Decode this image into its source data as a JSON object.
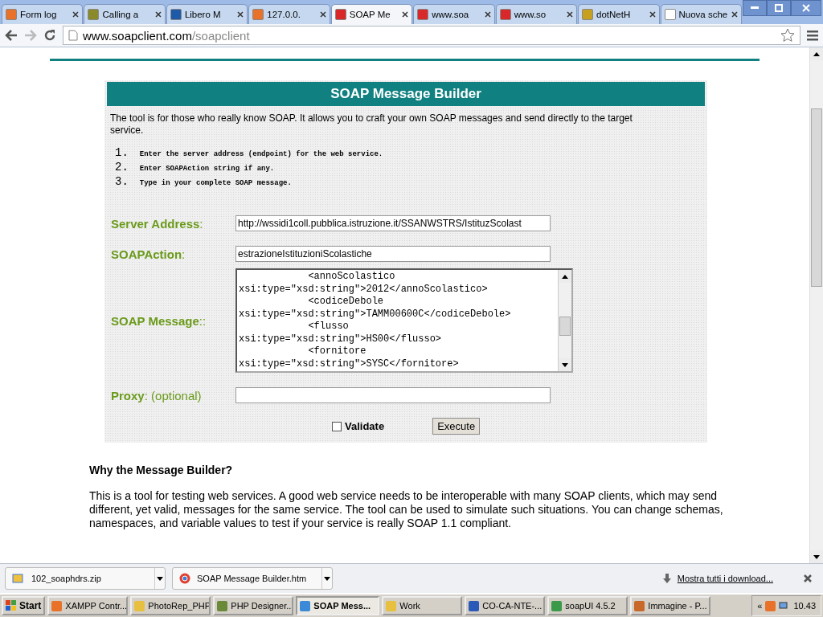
{
  "browser": {
    "tabs": [
      {
        "label": "Form log",
        "selected": false,
        "color": "#e8722a"
      },
      {
        "label": "Calling a",
        "selected": false,
        "color": "#8a8a2a"
      },
      {
        "label": "Libero M",
        "selected": false,
        "color": "#1e5aa8"
      },
      {
        "label": "127.0.0.",
        "selected": false,
        "color": "#e8722a"
      },
      {
        "label": "SOAP Me",
        "selected": true,
        "color": "#d8282a"
      },
      {
        "label": "www.soa",
        "selected": false,
        "color": "#d8282a"
      },
      {
        "label": "www.so",
        "selected": false,
        "color": "#d8282a"
      },
      {
        "label": "dotNetH",
        "selected": false,
        "color": "#c8a020"
      },
      {
        "label": "Nuova sche",
        "selected": false,
        "color": "#ffffff"
      }
    ],
    "url_host": "www.soapclient.com",
    "url_path": "/soapclient"
  },
  "builder": {
    "title": "SOAP Message Builder",
    "intro": "The tool is for those who really know  SOAP. It allows you to craft your own  SOAP messages and send directly  to the target service.",
    "steps": [
      {
        "number": "1.",
        "text": "Enter the server address (endpoint) for the web service."
      },
      {
        "number": "2.",
        "text": "Enter SOAPAction string if any."
      },
      {
        "number": "3.",
        "text": "Type in your complete SOAP message."
      }
    ],
    "server_address": {
      "label": "Server Address",
      "suffix": ":",
      "value": "http://wssidi1coll.pubblica.istruzione.it/SSANWSTRS/IstituzScolast"
    },
    "soap_action": {
      "label": "SOAPAction",
      "suffix": ":",
      "value": "estrazioneIstituzioniScolastiche"
    },
    "soap_message": {
      "label": "SOAP Message",
      "suffix": "::",
      "lines": [
        "            <annoScolastico",
        "xsi:type=\"xsd:string\">2012</annoScolastico>",
        "            <codiceDebole",
        "xsi:type=\"xsd:string\">TAMM00600C</codiceDebole>",
        "            <flusso",
        "xsi:type=\"xsd:string\">HS00</flusso>",
        "            <fornitore",
        "xsi:type=\"xsd:string\">SYSC</fornitore>"
      ]
    },
    "proxy": {
      "label": "Proxy",
      "suffix": ": (optional)"
    },
    "validate": {
      "label": "Validate",
      "checked": false
    },
    "execute_label": "Execute"
  },
  "why": {
    "heading": "Why the Message Builder?",
    "text": "This is a tool for testing web services. A good web service needs to be interoperable with many SOAP clients, which may send different, yet valid, messages for the same service. The tool can be used to simulate such situations. You can change schemas, namespaces, and variable values to test if your service is really SOAP 1.1 compliant."
  },
  "downloads": {
    "items": [
      {
        "name": "102_soaphdrs.zip",
        "kind": "zip"
      },
      {
        "name": "SOAP Message Builder.htm",
        "kind": "chrome"
      }
    ],
    "show_all": "Mostra tutti i download..."
  },
  "taskbar": {
    "start": "Start",
    "items": [
      {
        "label": "XAMPP Contr...",
        "selected": false,
        "color": "#e8722a"
      },
      {
        "label": "PhotoRep_PHP",
        "selected": false,
        "color": "#e8c040"
      },
      {
        "label": "PHP Designer...",
        "selected": false,
        "color": "#6a8a3a"
      },
      {
        "label": "SOAP Mess...",
        "selected": true,
        "color": "#3a8ad8"
      },
      {
        "label": "Work",
        "selected": false,
        "color": "#e8c040"
      },
      {
        "label": "CO-CA-NTE-...",
        "selected": false,
        "color": "#2a5ab8"
      },
      {
        "label": "soapUI 4.5.2",
        "selected": false,
        "color": "#3a9a4a"
      },
      {
        "label": "Immagine - P...",
        "selected": false,
        "color": "#c8682a"
      }
    ],
    "tray_expand": "«",
    "time": "10.43"
  }
}
